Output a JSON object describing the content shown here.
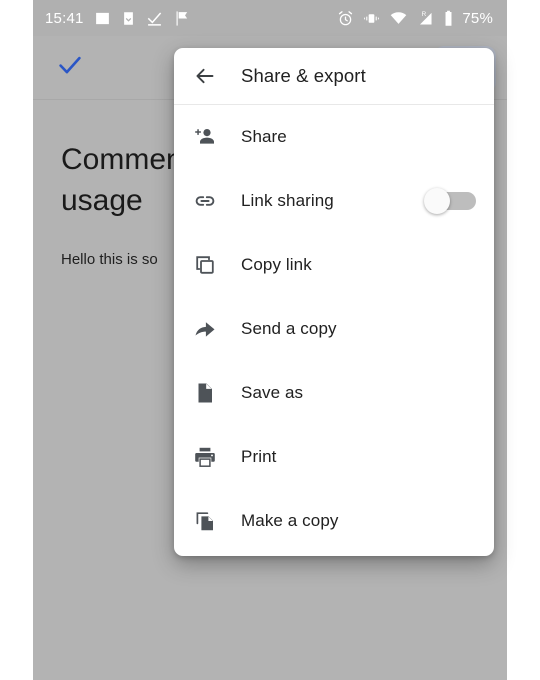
{
  "status_bar": {
    "time": "15:41",
    "battery_percent": "75%",
    "left_icons": [
      "image-icon",
      "download-icon",
      "task-done-icon",
      "flag-check-icon"
    ],
    "right_icons": [
      "alarm-icon",
      "vibrate-icon",
      "wifi-icon",
      "signal-roaming-icon",
      "battery-icon"
    ],
    "signal_label": "R",
    "background_color": "#b0b0b0",
    "foreground_color": "#ffffff"
  },
  "app": {
    "toolbar": {
      "confirm_icon": "check-icon",
      "confirm_color": "#2a56c6",
      "overflow_highlight": "highlighted-button"
    },
    "document": {
      "title": "Comment\nusage",
      "body": "Hello this is so"
    },
    "scrim_color": "#b3b3b3"
  },
  "dialog": {
    "header": {
      "back_icon": "arrow-back-icon",
      "title": "Share & export"
    },
    "items": [
      {
        "icon": "person-add-icon",
        "label": "Share",
        "trailing": "none"
      },
      {
        "icon": "link-icon",
        "label": "Link sharing",
        "trailing": "toggle",
        "toggle_on": false
      },
      {
        "icon": "copy-link-icon",
        "label": "Copy link",
        "trailing": "none"
      },
      {
        "icon": "send-arrow-icon",
        "label": "Send a copy",
        "trailing": "none"
      },
      {
        "icon": "document-icon",
        "label": "Save as",
        "trailing": "none"
      },
      {
        "icon": "printer-icon",
        "label": "Print",
        "trailing": "none"
      },
      {
        "icon": "file-copy-icon",
        "label": "Make a copy",
        "trailing": "none"
      }
    ],
    "icon_color": "#4e5358",
    "text_color": "#212121",
    "background_color": "#ffffff"
  }
}
